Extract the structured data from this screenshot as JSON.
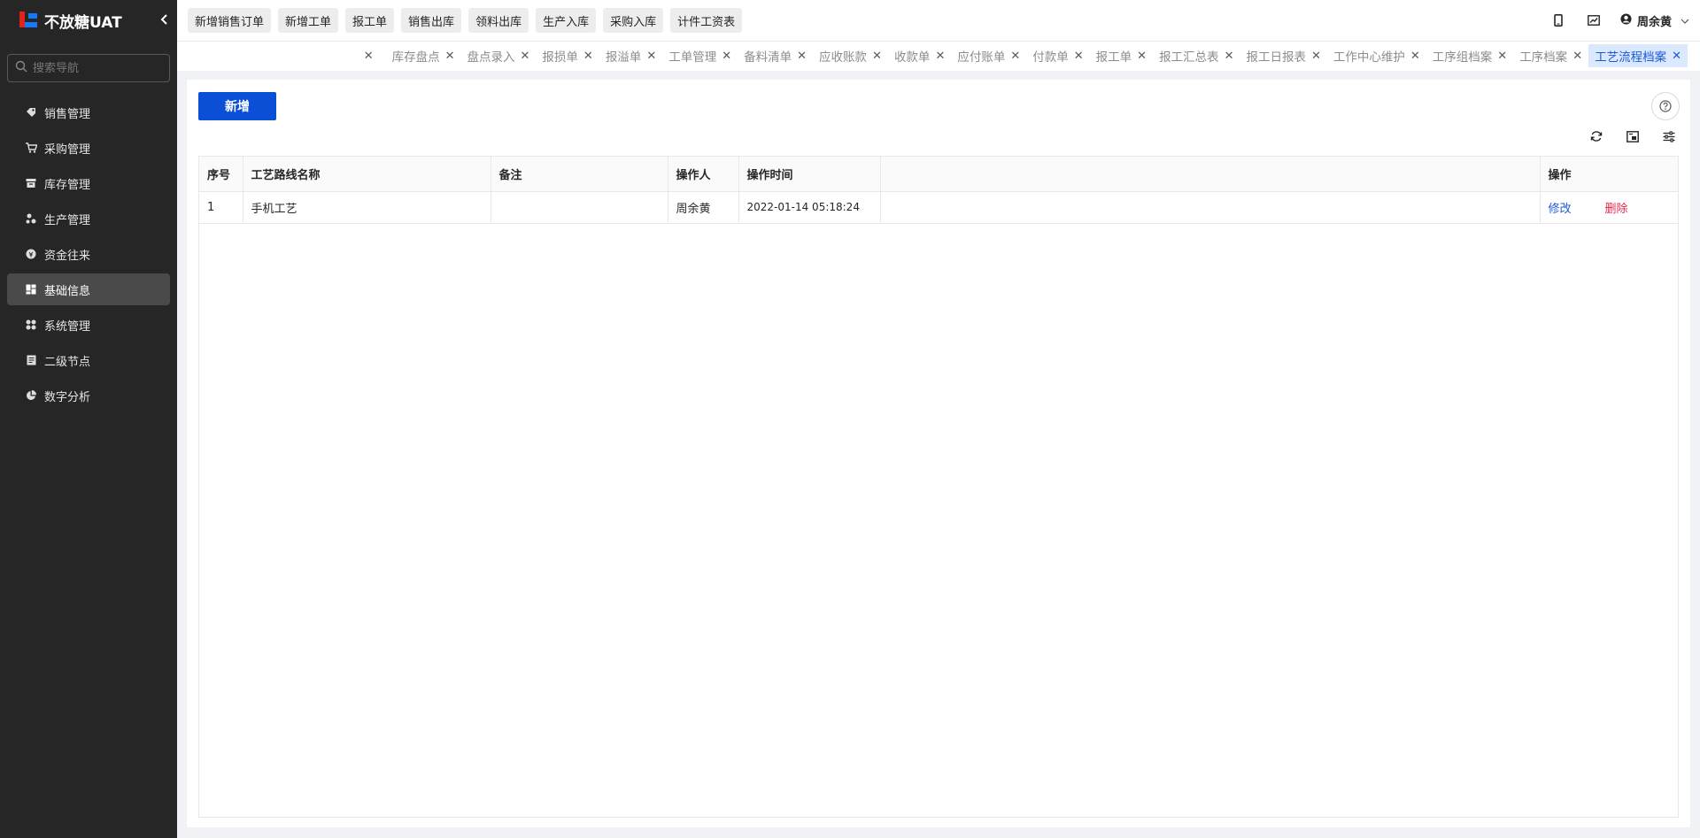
{
  "app": {
    "title": "不放糖UAT",
    "collapse_icon": "chevron-left-icon"
  },
  "sidebar": {
    "search_placeholder": "搜索导航",
    "items": [
      {
        "label": "销售管理",
        "icon": "tag-icon"
      },
      {
        "label": "采购管理",
        "icon": "cart-icon"
      },
      {
        "label": "库存管理",
        "icon": "archive-icon"
      },
      {
        "label": "生产管理",
        "icon": "cluster-icon"
      },
      {
        "label": "资金往来",
        "icon": "money-icon"
      },
      {
        "label": "基础信息",
        "icon": "dashboard-icon",
        "active": true
      },
      {
        "label": "系统管理",
        "icon": "apps-icon"
      },
      {
        "label": "二级节点",
        "icon": "document-icon"
      },
      {
        "label": "数字分析",
        "icon": "pie-chart-icon"
      }
    ]
  },
  "toolbar": {
    "quick": [
      "新增销售订单",
      "新增工单",
      "报工单",
      "销售出库",
      "领料出库",
      "生产入库",
      "采购入库",
      "计件工资表"
    ],
    "icons": [
      "mobile-icon",
      "chart-icon"
    ],
    "user_name": "周余黄"
  },
  "tabs": {
    "items": [
      {
        "label": "库存盘点"
      },
      {
        "label": "盘点录入"
      },
      {
        "label": "报损单"
      },
      {
        "label": "报溢单"
      },
      {
        "label": "工单管理"
      },
      {
        "label": "备料清单"
      },
      {
        "label": "应收账款"
      },
      {
        "label": "收款单"
      },
      {
        "label": "应付账单"
      },
      {
        "label": "付款单"
      },
      {
        "label": "报工单"
      },
      {
        "label": "报工汇总表"
      },
      {
        "label": "报工日报表"
      },
      {
        "label": "工作中心维护"
      },
      {
        "label": "工序组档案"
      },
      {
        "label": "工序档案"
      },
      {
        "label": "工艺流程档案",
        "active": true
      }
    ],
    "close_glyph": "✕"
  },
  "main": {
    "add_label": "新增",
    "table": {
      "headers": [
        "序号",
        "工艺路线名称",
        "备注",
        "操作人",
        "操作时间",
        "",
        "操作"
      ],
      "rows": [
        {
          "index": "1",
          "name": "手机工艺",
          "remark": "",
          "operator": "周余黄",
          "time": "2022-01-14 05:18:24",
          "edit": "修改",
          "delete": "删除"
        }
      ]
    }
  },
  "colors": {
    "primary": "#0b4fd6",
    "link": "#1d58d6",
    "danger": "#e0294a",
    "sidebar_bg": "#262626"
  }
}
